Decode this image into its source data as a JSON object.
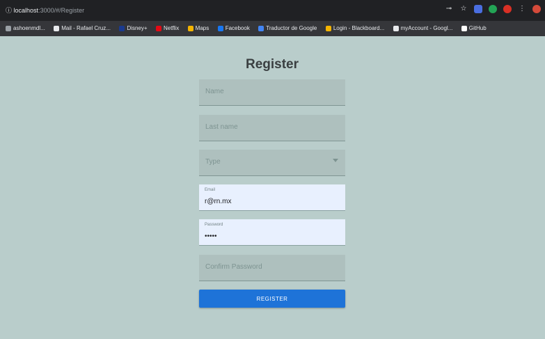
{
  "browser": {
    "address_host": "localhost",
    "address_path": ":3000/#/Register",
    "bookmarks": [
      {
        "label": "ashoenmdl...",
        "color": "#9aa0a6"
      },
      {
        "label": "Mail - Rafael Cruz...",
        "color": "#e8eaed"
      },
      {
        "label": "Disney+",
        "color": "#1a3a8f"
      },
      {
        "label": "Netflix",
        "color": "#e50914"
      },
      {
        "label": "Maps",
        "color": "#f4b400"
      },
      {
        "label": "Facebook",
        "color": "#1877f2"
      },
      {
        "label": "Traductor de Google",
        "color": "#4285f4"
      },
      {
        "label": "Login - Blackboard...",
        "color": "#f4b400"
      },
      {
        "label": "myAccount - Googl...",
        "color": "#e8eaed"
      },
      {
        "label": "GitHub",
        "color": "#ffffff"
      }
    ]
  },
  "form": {
    "title": "Register",
    "name_placeholder": "Name",
    "lastname_placeholder": "Last name",
    "type_placeholder": "Type",
    "email_label": "Email",
    "email_value": "r@rn.mx",
    "password_label": "Password",
    "password_value": "•••••",
    "confirm_placeholder": "Confirm Password",
    "register_label": "REGISTER"
  },
  "colors": {
    "page_background": "#b9cdcb",
    "button": "#1e73d8",
    "filled_field": "#e8f0fe"
  }
}
